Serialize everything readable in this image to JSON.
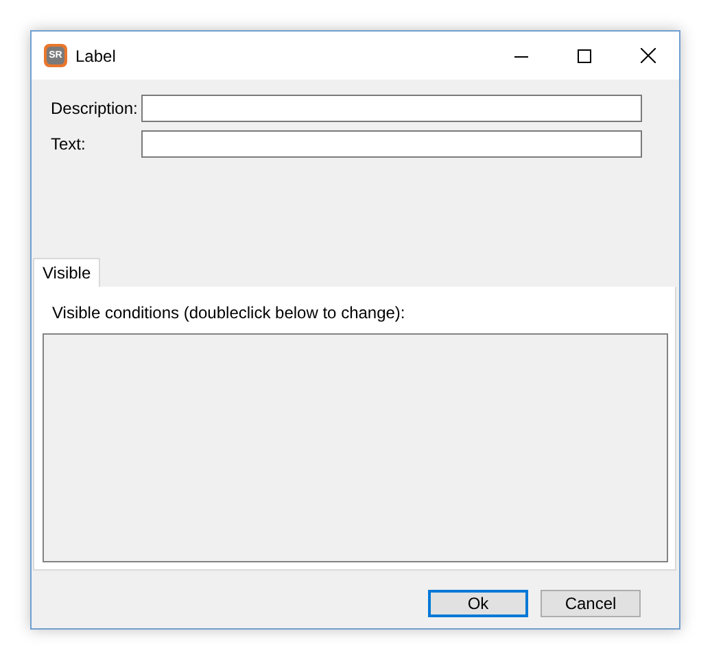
{
  "window": {
    "title": "Label",
    "app_icon_text": "SR"
  },
  "fields": [
    {
      "label": "Description:"
    },
    {
      "label": "Text:"
    }
  ],
  "tabs": [
    {
      "label": "Visible",
      "selected": true
    }
  ],
  "panel": {
    "caption": "Visible conditions (doubleclick below to change):"
  },
  "buttons": [
    {
      "label": "Ok",
      "default": true
    },
    {
      "label": "Cancel",
      "default": false
    }
  ]
}
